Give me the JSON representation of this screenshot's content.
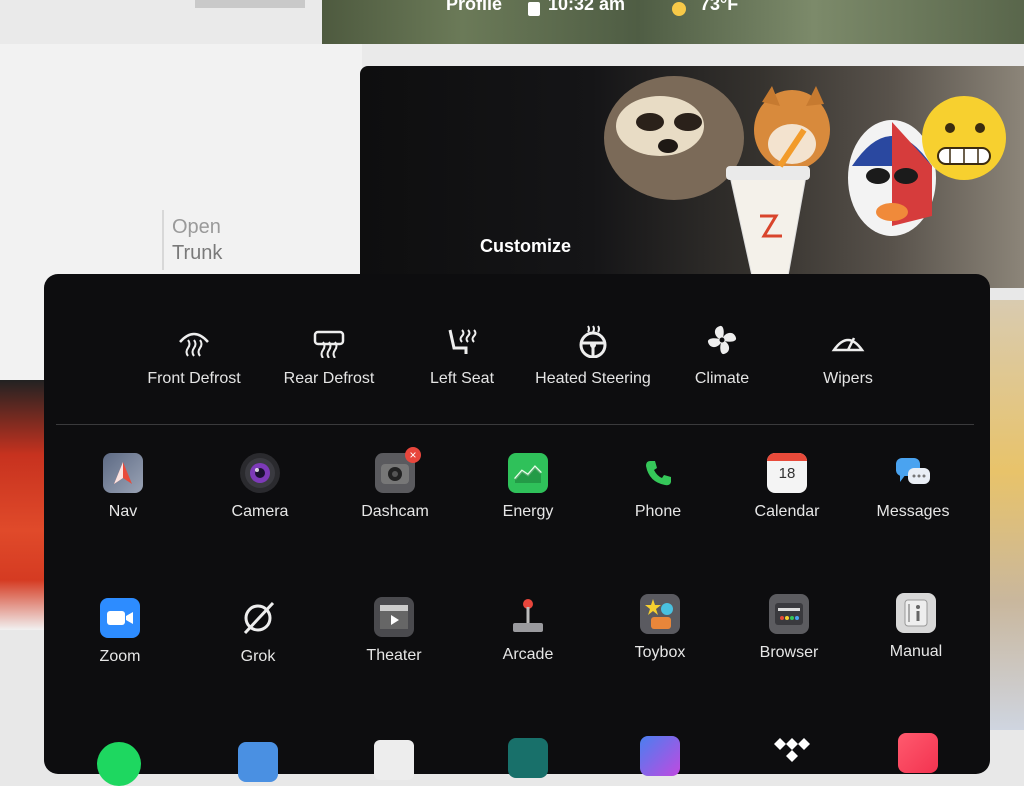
{
  "status_bar": {
    "profile_label": "Profile",
    "time": "10:32 am",
    "temperature": "73°F"
  },
  "trunk": {
    "line1": "Open",
    "line2": "Trunk"
  },
  "camera": {
    "customize_label": "Customize"
  },
  "quick_controls": [
    {
      "label": "Front Defrost",
      "icon": "front-defrost-icon"
    },
    {
      "label": "Rear Defrost",
      "icon": "rear-defrost-icon"
    },
    {
      "label": "Left Seat",
      "icon": "seat-heat-icon"
    },
    {
      "label": "Heated Steering",
      "icon": "heated-steering-icon"
    },
    {
      "label": "Climate",
      "icon": "fan-icon"
    },
    {
      "label": "Wipers",
      "icon": "wipers-icon"
    }
  ],
  "apps_row1": [
    {
      "label": "Nav",
      "icon": "nav-icon"
    },
    {
      "label": "Camera",
      "icon": "camera-icon"
    },
    {
      "label": "Dashcam",
      "icon": "dashcam-icon"
    },
    {
      "label": "Energy",
      "icon": "energy-icon"
    },
    {
      "label": "Phone",
      "icon": "phone-icon"
    },
    {
      "label": "Calendar",
      "icon": "calendar-icon",
      "day": "18"
    },
    {
      "label": "Messages",
      "icon": "messages-icon"
    }
  ],
  "apps_row2": [
    {
      "label": "Zoom",
      "icon": "zoom-icon"
    },
    {
      "label": "Grok",
      "icon": "grok-icon"
    },
    {
      "label": "Theater",
      "icon": "theater-icon"
    },
    {
      "label": "Arcade",
      "icon": "arcade-icon"
    },
    {
      "label": "Toybox",
      "icon": "toybox-icon"
    },
    {
      "label": "Browser",
      "icon": "browser-icon"
    },
    {
      "label": "Manual",
      "icon": "manual-icon"
    }
  ],
  "apps_row3_icons": [
    "spotify-icon",
    "bluetooth-icon",
    "document-icon",
    "shuffle-icon",
    "mic-icon",
    "tidal-icon",
    "music-icon"
  ],
  "colors": {
    "panel": "#0d0d0f",
    "energy_green": "#2fc15a",
    "phone_green": "#35c759",
    "zoom_blue": "#2d8cff",
    "dashcam_badge": "#e8463c"
  }
}
